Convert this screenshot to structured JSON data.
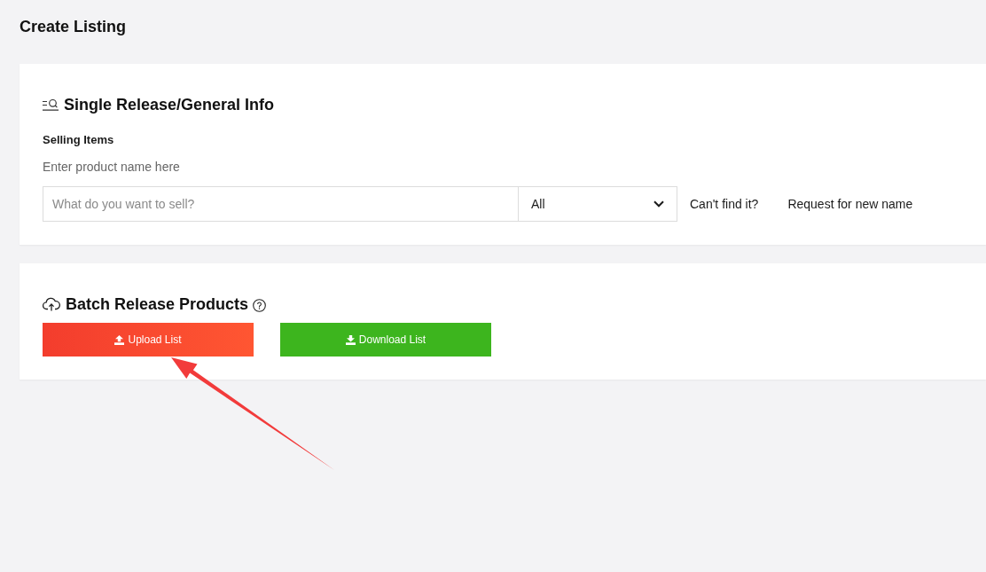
{
  "page": {
    "title": "Create Listing"
  },
  "single_release": {
    "title": "Single Release/General Info",
    "field_label": "Selling Items",
    "hint": "Enter product name here",
    "search": {
      "placeholder": "What do you want to sell?"
    },
    "category_select": {
      "value": "All"
    },
    "cant_find_text": "Can't find it?",
    "request_link": "Request for new name"
  },
  "batch_release": {
    "title": "Batch Release Products",
    "buttons": [
      {
        "label": "Upload List",
        "kind": "upload"
      },
      {
        "label": "Download List",
        "kind": "download"
      }
    ]
  }
}
